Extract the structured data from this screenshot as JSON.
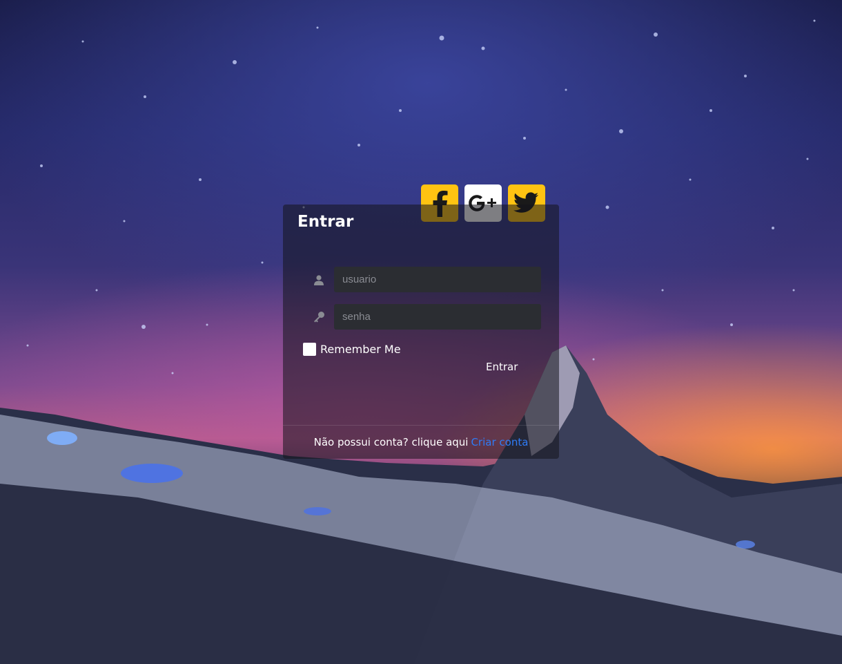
{
  "card": {
    "title": "Entrar",
    "username_placeholder": "usuario",
    "password_placeholder": "senha",
    "remember_label": "Remember Me",
    "submit_label": "Entrar",
    "footer_text": "Não possui conta? clique aqui",
    "footer_link": "Criar conta"
  },
  "socials": [
    {
      "name": "facebook",
      "icon": "facebook-icon",
      "color": "#ffc312"
    },
    {
      "name": "google-plus",
      "icon": "google-plus-icon",
      "color": "#ffffff"
    },
    {
      "name": "twitter",
      "icon": "twitter-icon",
      "color": "#ffc312"
    }
  ],
  "colors": {
    "accent": "#ffc312",
    "link": "#2f7cf6",
    "input_bg": "#2b2d32"
  }
}
